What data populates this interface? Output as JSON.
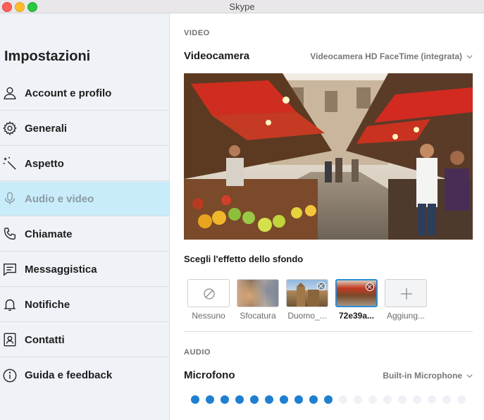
{
  "window": {
    "title": "Skype"
  },
  "sidebar": {
    "title": "Impostazioni",
    "items": [
      {
        "label": "Account e profilo",
        "icon": "person-icon",
        "active": false
      },
      {
        "label": "Generali",
        "icon": "gear-icon",
        "active": false
      },
      {
        "label": "Aspetto",
        "icon": "magic-wand-icon",
        "active": false
      },
      {
        "label": "Audio e video",
        "icon": "microphone-icon",
        "active": true
      },
      {
        "label": "Chiamate",
        "icon": "phone-icon",
        "active": false
      },
      {
        "label": "Messaggistica",
        "icon": "chat-icon",
        "active": false
      },
      {
        "label": "Notifiche",
        "icon": "bell-icon",
        "active": false
      },
      {
        "label": "Contatti",
        "icon": "contact-card-icon",
        "active": false
      },
      {
        "label": "Guida e feedback",
        "icon": "info-icon",
        "active": false
      }
    ]
  },
  "video": {
    "section_label": "VIDEO",
    "camera_label": "Videocamera",
    "camera_value": "Videocamera HD FaceTime (integrata)",
    "background_effect_heading": "Scegli l'effetto dello sfondo",
    "effects": [
      {
        "caption": "Nessuno",
        "selected": false
      },
      {
        "caption": "Sfocatura",
        "selected": false
      },
      {
        "caption": "Duomo_...",
        "selected": false
      },
      {
        "caption": "72e39a...",
        "selected": true
      },
      {
        "caption": "Aggiung...",
        "selected": false
      }
    ]
  },
  "audio": {
    "section_label": "AUDIO",
    "microphone_label": "Microfono",
    "microphone_value": "Built-in Microphone",
    "level_total_dots": 19,
    "level_active_dots": 10
  },
  "colors": {
    "accent": "#2a8dd4",
    "active_nav_bg": "#c9ecfa",
    "level_dot_active": "#1f7fd1",
    "level_dot_inactive": "#eef2f6"
  }
}
